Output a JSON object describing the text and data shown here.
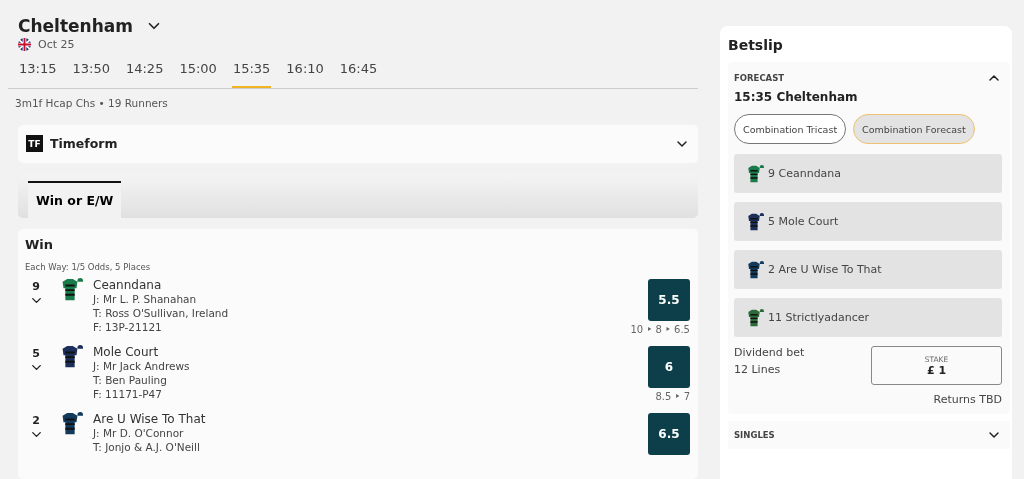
{
  "race": {
    "venue": "Cheltenham",
    "date": "Oct 25",
    "meta": "3m1f Hcap Chs • 19 Runners"
  },
  "times": [
    {
      "label": "13:15",
      "selected": false
    },
    {
      "label": "13:50",
      "selected": false
    },
    {
      "label": "14:25",
      "selected": false
    },
    {
      "label": "15:00",
      "selected": false
    },
    {
      "label": "15:35",
      "selected": true
    },
    {
      "label": "16:10",
      "selected": false
    },
    {
      "label": "16:45",
      "selected": false
    }
  ],
  "timeform": {
    "badge": "TF",
    "title": "Timeform",
    "expanded": false
  },
  "market_tabs": [
    {
      "label": "Win or E/W",
      "selected": true
    }
  ],
  "market": {
    "title": "Win",
    "terms": "Each Way: 1/5 Odds, 5 Places"
  },
  "runners": [
    {
      "number": "9",
      "name": "Ceanndana",
      "jockey": "J: Mr L. P. Shanahan",
      "trainer": "T: Ross O'Sullivan, Ireland",
      "form": "F: 13P-21121",
      "odds": "5.5",
      "history": "10 ‣ 8 ‣ 6.5",
      "color": "#1a7a4a"
    },
    {
      "number": "5",
      "name": "Mole Court",
      "jockey": "J: Mr Jack Andrews",
      "trainer": "T: Ben Pauling",
      "form": "F: 11171-P47",
      "odds": "6",
      "history": "8.5 ‣ 7",
      "color": "#1c2f5a"
    },
    {
      "number": "2",
      "name": "Are U Wise To That",
      "jockey": "J: Mr D. O'Connor",
      "trainer": "T: Jonjo & A.J. O'Neill",
      "odds": "6.5",
      "color": "#123a5c"
    }
  ],
  "betslip": {
    "title": "Betslip",
    "section": "FORECAST",
    "expanded": true,
    "race": "15:35 Cheltenham",
    "bet_types": [
      {
        "label": "Combination Tricast",
        "selected": false
      },
      {
        "label": "Combination Forecast",
        "selected": true
      }
    ],
    "selections": [
      {
        "label": "9 Ceanndana",
        "color": "#1a7a4a"
      },
      {
        "label": "5 Mole Court",
        "color": "#1c2f5a"
      },
      {
        "label": "2 Are U Wise To That",
        "color": "#123a5c"
      },
      {
        "label": "11 Strictlyadancer",
        "color": "#2d6a3a"
      }
    ],
    "bet_name": "Dividend bet",
    "lines": "12 Lines",
    "stake_label": "STAKE",
    "stake": "£ 1",
    "returns": "Returns TBD",
    "singles": {
      "label": "SINGLES",
      "expanded": false
    }
  }
}
